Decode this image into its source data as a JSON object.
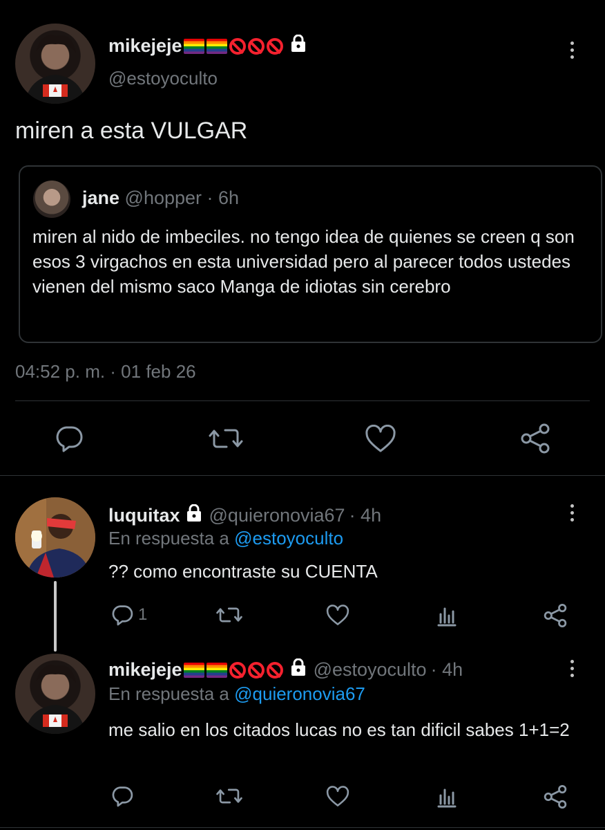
{
  "main_tweet": {
    "display_name": "mikejeje",
    "handle": "@estoyoculto",
    "text": "miren a esta VULGAR",
    "timestamp": "04:52 p. m. · 01 feb 26",
    "quoted": {
      "display_name": "jane",
      "handle": "@hopper",
      "time": "· 6h",
      "text": "miren al nido de imbeciles. no tengo idea de quienes se creen q son esos 3 virgachos en esta universidad pero al parecer todos ustedes vienen del mismo saco Manga de idiotas sin cerebro"
    },
    "actions": [
      "reply-icon",
      "retweet-icon",
      "like-icon",
      "share-icon"
    ]
  },
  "replies": [
    {
      "display_name": "luquitax",
      "handle": "@quieronovia67",
      "time": "· 4h",
      "reply_prefix": "En respuesta a",
      "reply_to": "@estoyoculto",
      "text": "?? como encontraste su CUENTA",
      "reply_count": "1"
    },
    {
      "display_name": "mikejeje",
      "handle": "@estoyoculto",
      "time": "· 4h",
      "reply_prefix": "En respuesta a",
      "reply_to": "@quieronovia67",
      "text": "me salio en los citados lucas no es tan dificil sabes 1+1=2",
      "reply_count": ""
    }
  ],
  "colors": {
    "background": "#000000",
    "text": "#e7e9ea",
    "secondary": "#71767b",
    "link": "#1d9bf0",
    "divider": "#2f3336"
  }
}
